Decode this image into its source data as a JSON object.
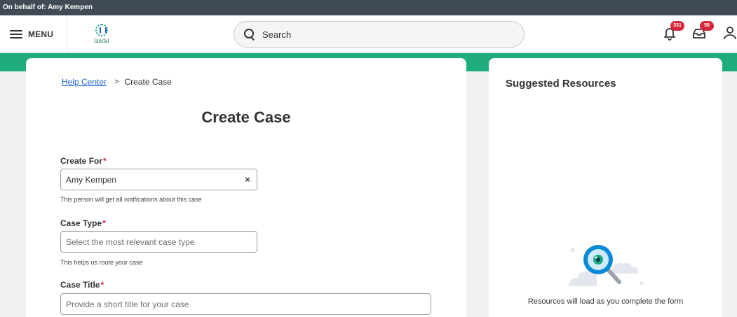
{
  "delegation": {
    "text": "On behalf of: Amy Kempen"
  },
  "header": {
    "menu_label": "MENU",
    "logo_text": "landal",
    "search_placeholder": "Search",
    "notifications_count": "331",
    "inbox_count": "58"
  },
  "breadcrumb": {
    "parent": "Help Center",
    "separator": ">",
    "current": "Create Case"
  },
  "form": {
    "title": "Create Case",
    "create_for": {
      "label": "Create For",
      "required_mark": "*",
      "value": "Amy Kempen",
      "clear_glyph": "×",
      "hint": "This person will get all notifications about this case"
    },
    "case_type": {
      "label": "Case Type",
      "required_mark": "*",
      "placeholder": "Select the most relevant case type",
      "hint": "This helps us route your case"
    },
    "case_title": {
      "label": "Case Title",
      "required_mark": "*",
      "placeholder": "Provide a short title for your case"
    }
  },
  "suggested": {
    "title": "Suggested Resources",
    "message": "Resources will load as you complete the form"
  },
  "colors": {
    "delegation_bg": "#3f4a55",
    "brand_green": "#1eac7d",
    "link_blue": "#1d63d6",
    "badge_red": "#d6283b"
  },
  "icons": {
    "menu": "hamburger-icon",
    "search": "search-icon",
    "notifications": "bell-icon",
    "inbox": "inbox-tray-icon",
    "profile": "person-icon",
    "clear": "close-icon",
    "breadcrumb_separator": "chevron-right-icon"
  }
}
